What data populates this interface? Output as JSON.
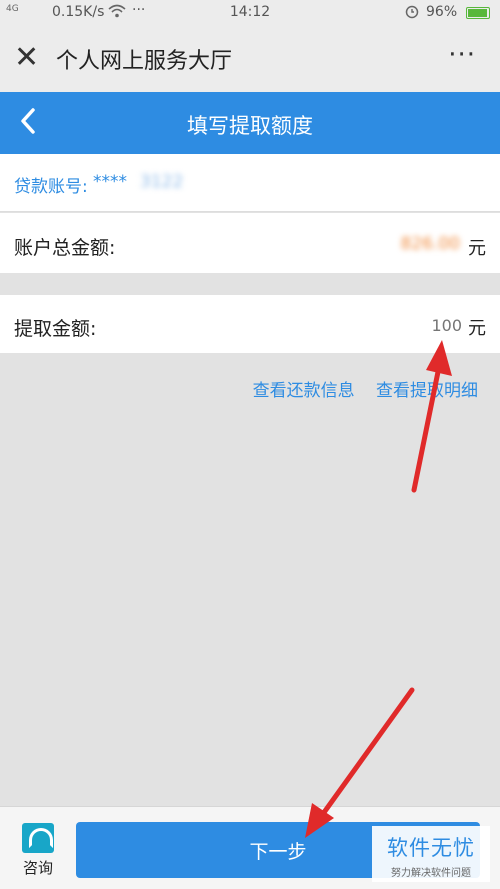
{
  "status_bar": {
    "signal": "4G",
    "speed": "0.15K/s",
    "dots": "···",
    "time": "14:12",
    "battery": "96%"
  },
  "header": {
    "title": "个人网上服务大厅",
    "close_glyph": "✕",
    "more_glyph": "···"
  },
  "nav": {
    "title": "填写提取额度",
    "back_glyph": "‹"
  },
  "account": {
    "label": "贷款账号:",
    "masked": "****",
    "blurred_tail": "3122"
  },
  "total": {
    "label": "账户总金额:",
    "amount": "826.00",
    "unit": "元"
  },
  "withdraw": {
    "label": "提取金额:",
    "placeholder": "100",
    "unit": "元"
  },
  "links": {
    "repayment_info": "查看还款信息",
    "withdraw_detail": "查看提取明细"
  },
  "bottom": {
    "consult_label": "咨询",
    "next_label": "下一步"
  },
  "watermark": {
    "main": "软件无忧",
    "sub": "努力解决软件问题"
  },
  "colors": {
    "primary": "#2e8ce2",
    "annotation_arrow": "#e02a2a"
  }
}
